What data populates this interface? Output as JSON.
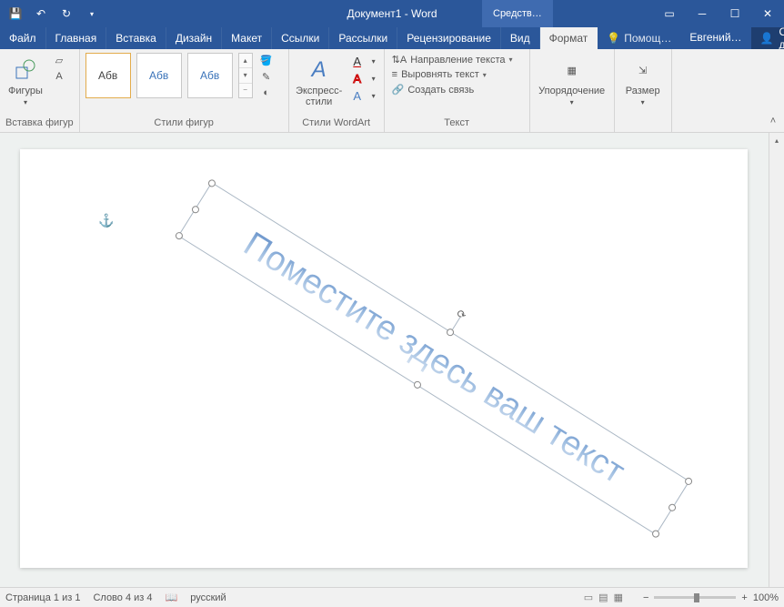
{
  "titlebar": {
    "title": "Документ1 - Word",
    "contextual": "Средств…"
  },
  "tabs": {
    "file": "Файл",
    "items": [
      "Главная",
      "Вставка",
      "Дизайн",
      "Макет",
      "Ссылки",
      "Рассылки",
      "Рецензирование",
      "Вид",
      "Формат"
    ],
    "active": "Формат",
    "tell_me": "Помощ…",
    "user": "Евгений…",
    "share": "Общий доступ"
  },
  "ribbon": {
    "shapes": {
      "label": "Фигуры",
      "group": "Вставка фигур"
    },
    "styles": {
      "sample": "Абв",
      "group": "Стили фигур"
    },
    "wordart": {
      "label": "Экспресс-\nстили",
      "group": "Стили WordArt"
    },
    "text": {
      "direction": "Направление текста",
      "align": "Выровнять текст",
      "link": "Создать связь",
      "group": "Текст"
    },
    "arrange": {
      "label": "Упорядочение"
    },
    "size": {
      "label": "Размер"
    }
  },
  "document": {
    "wordart_text": "Поместите здесь ваш текст"
  },
  "status": {
    "page": "Страница 1 из 1",
    "words": "Слово 4 из 4",
    "lang": "русский",
    "zoom": "100%"
  }
}
